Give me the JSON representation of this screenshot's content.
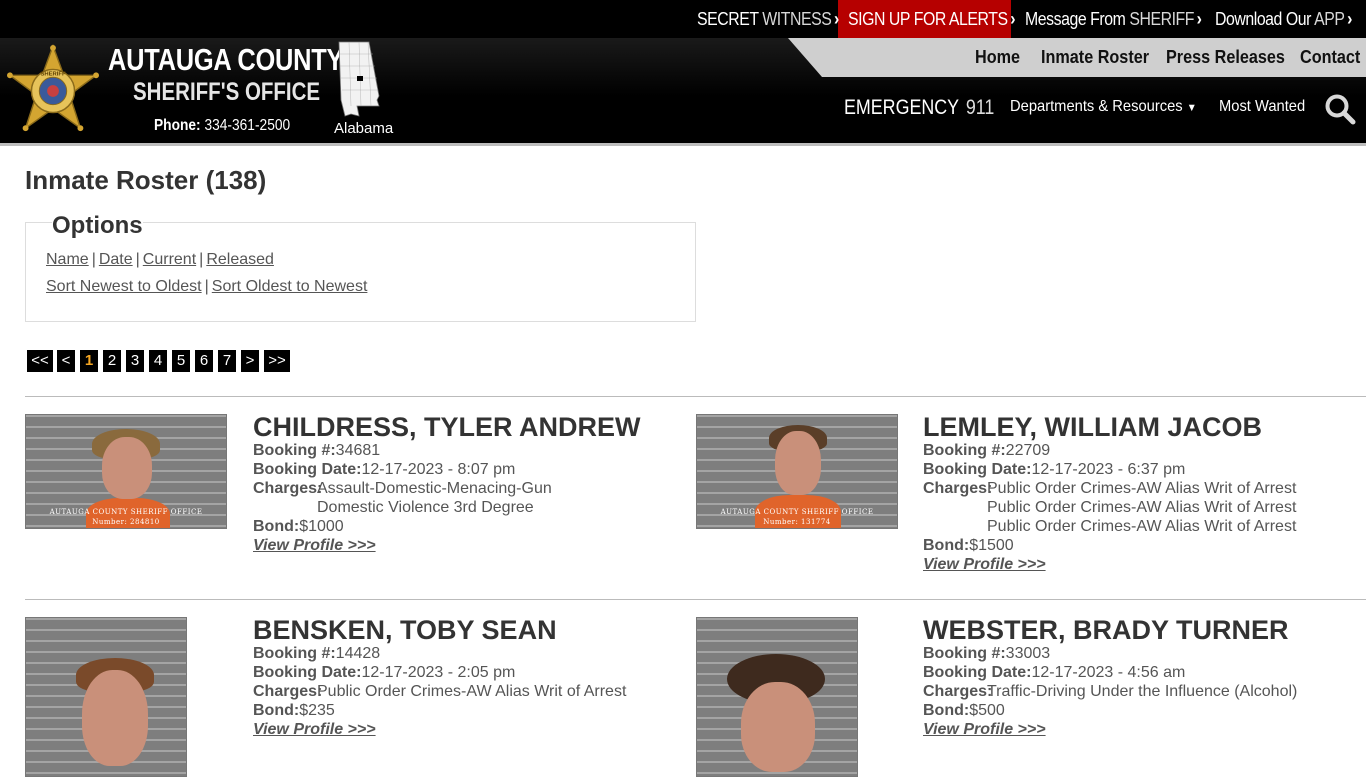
{
  "topbar": {
    "secret_witness": [
      "SECRET",
      "WITNESS"
    ],
    "alerts": [
      "SIGN UP FOR ALERTS"
    ],
    "message": [
      "Message From",
      "SHERIFF"
    ],
    "app": [
      "Download Our",
      "APP"
    ],
    "chev": "›",
    "alerts_bg": "#b60000"
  },
  "header": {
    "brand_line1": "AUTAUGA COUNTY",
    "brand_line2": "SHERIFF'S OFFICE",
    "phone_label": "Phone:",
    "phone_number": "334-361-2500",
    "state": "Alabama",
    "badge_text": "SHERIFF",
    "nav": {
      "home": "Home",
      "roster": "Inmate Roster",
      "press": "Press Releases",
      "contact": "Contact"
    },
    "emergency_label": "EMERGENCY",
    "emergency_number": "911",
    "departments": "Departments & Resources",
    "most_wanted": "Most Wanted"
  },
  "page": {
    "title": "Inmate Roster (138)",
    "options_label": "Options",
    "filters": [
      "Name",
      "Date",
      "Current",
      "Released"
    ],
    "sorts": [
      "Sort Newest to Oldest",
      "Sort Oldest to Newest"
    ],
    "pagination": [
      "<<",
      "<",
      "1",
      "2",
      "3",
      "4",
      "5",
      "6",
      "7",
      ">",
      ">>"
    ],
    "current_page": "1"
  },
  "labels": {
    "booking": "Booking #:",
    "booking_date": "Booking Date:",
    "charges": "Charges:",
    "bond": "Bond:",
    "view_profile": "View Profile >>>"
  },
  "inmates": [
    {
      "name": "CHILDRESS, TYLER ANDREW",
      "booking": "34681",
      "date": "12-17-2023 - 8:07 pm",
      "charges": [
        "Assault-Domestic-Menacing-Gun",
        "Domestic Violence 3rd Degree"
      ],
      "bond": "$1000",
      "plate": [
        "AUTAUGA COUNTY SHERIFF OFFICE",
        "Number: 284810"
      ]
    },
    {
      "name": "LEMLEY, WILLIAM JACOB",
      "booking": "22709",
      "date": "12-17-2023 - 6:37 pm",
      "charges": [
        "Public Order Crimes-AW Alias Writ of Arrest",
        "Public Order Crimes-AW Alias Writ of Arrest",
        "Public Order Crimes-AW Alias Writ of Arrest"
      ],
      "bond": "$1500",
      "plate": [
        "AUTAUGA COUNTY SHERIFF OFFICE",
        "Number: 131774"
      ]
    },
    {
      "name": "BENSKEN, TOBY SEAN",
      "booking": "14428",
      "date": "12-17-2023 - 2:05 pm",
      "charges": [
        "Public Order Crimes-AW Alias Writ of Arrest"
      ],
      "bond": "$235",
      "plate": []
    },
    {
      "name": "WEBSTER, BRADY TURNER",
      "booking": "33003",
      "date": "12-17-2023 - 4:56 am",
      "charges": [
        "Traffic-Driving Under the Influence (Alcohol)"
      ],
      "bond": "$500",
      "plate": []
    }
  ]
}
